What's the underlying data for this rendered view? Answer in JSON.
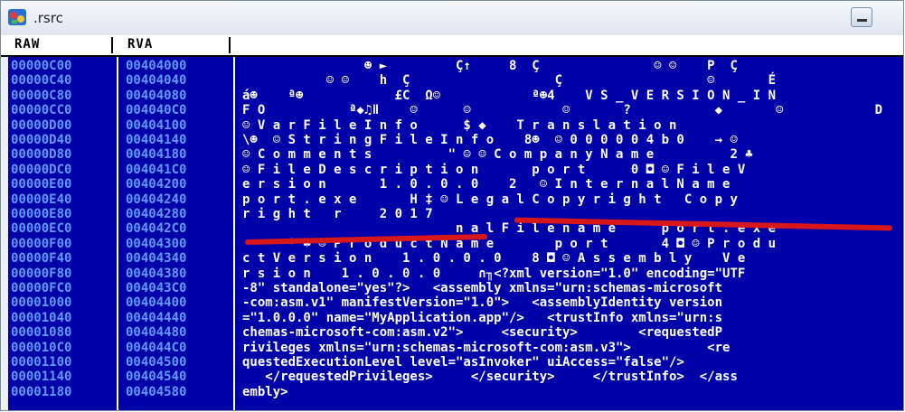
{
  "window": {
    "title": ".rsrc"
  },
  "columns": {
    "raw": "RAW",
    "rva": "RVA"
  },
  "rows": [
    {
      "raw": "00000C00",
      "rva": "00404000",
      "text": "                ☻ ►         Ç↑     8  Ç               ☺ ☺    P  Ç"
    },
    {
      "raw": "00000C40",
      "rva": "00404040",
      "text": "           ☺ ☺    h  Ç                   Ç                   ☺       É"
    },
    {
      "raw": "00000C80",
      "rva": "00404080",
      "text": "á☻    ª☻            £C  Ω☺            ª☻4    V S _ V E R S I O N _ I N"
    },
    {
      "raw": "00000CC0",
      "rva": "004040C0",
      "text": "F O           ª◆♫ǁ    ☺      ☺            ☺       ?           ◆       ☺            D"
    },
    {
      "raw": "00000D00",
      "rva": "00404100",
      "text": "☺ V a r F i l e I n f o      $ ◆    T r a n s l a t i o n"
    },
    {
      "raw": "00000D40",
      "rva": "00404140",
      "text": "\\☻  ☺ S t r i n g F i l e I n f o    8☻  ☺ 0 0 0 0 0 4 b 0    → ☺"
    },
    {
      "raw": "00000D80",
      "rva": "00404180",
      "text": "☺ C o m m e n t s          \" ☺ ☺ C o m p a n y N a m e          2 ♣"
    },
    {
      "raw": "00000DC0",
      "rva": "004041C0",
      "text": "☺ F i l e D e s c r i p t i o n       p o r t      0 ◘ ☺ F i l e V"
    },
    {
      "raw": "00000E00",
      "rva": "00404200",
      "text": "e r s i o n       1 . 0 . 0 . 0    2   ☺ I n t e r n a l N a m e"
    },
    {
      "raw": "00000E40",
      "rva": "00404240",
      "text": "p o r t . e x e       H ‡ ☺ L e g a l C o p y r i g h t   C o p y"
    },
    {
      "raw": "00000E80",
      "rva": "00404280",
      "text": "r i g h t   r     2 0 1 7"
    },
    {
      "raw": "00000EC0",
      "rva": "004042C0",
      "text": "                            n a l F i l e n a m e      p o r t . e x e"
    },
    {
      "raw": "00000F00",
      "rva": "00404300",
      "text": "      * ♣ ☺ P r o d u c t N a m e        p o r t       4 ◘ ☺ P r o d u"
    },
    {
      "raw": "00000F40",
      "rva": "00404340",
      "text": "c t V e r s i o n    1 . 0 . 0 . 0    8 ◘ ☺ A s s e m b l y    V e"
    },
    {
      "raw": "00000F80",
      "rva": "00404380",
      "text": "r s i o n    1 . 0 . 0 . 0     ∩╖<?xml version=\"1.0\" encoding=\"UTF"
    },
    {
      "raw": "00000FC0",
      "rva": "004043C0",
      "text": "-8\" standalone=\"yes\"?>   <assembly xmlns=\"urn:schemas-microsoft"
    },
    {
      "raw": "00001000",
      "rva": "00404400",
      "text": "-com:asm.v1\" manifestVersion=\"1.0\">   <assemblyIdentity version"
    },
    {
      "raw": "00001040",
      "rva": "00404440",
      "text": "=\"1.0.0.0\" name=\"MyApplication.app\"/>   <trustInfo xmlns=\"urn:s"
    },
    {
      "raw": "00001080",
      "rva": "00404480",
      "text": "chemas-microsoft-com:asm.v2\">     <security>        <requestedP"
    },
    {
      "raw": "000010C0",
      "rva": "004044C0",
      "text": "rivileges xmlns=\"urn:schemas-microsoft-com:asm.v3\">          <re"
    },
    {
      "raw": "00001100",
      "rva": "00404500",
      "text": "questedExecutionLevel level=\"asInvoker\" uiAccess=\"false\"/>"
    },
    {
      "raw": "00001140",
      "rva": "00404540",
      "text": "   </requestedPrivileges>     </security>     </trustInfo>  </ass"
    },
    {
      "raw": "00001180",
      "rva": "00404580",
      "text": "embly>"
    }
  ]
}
